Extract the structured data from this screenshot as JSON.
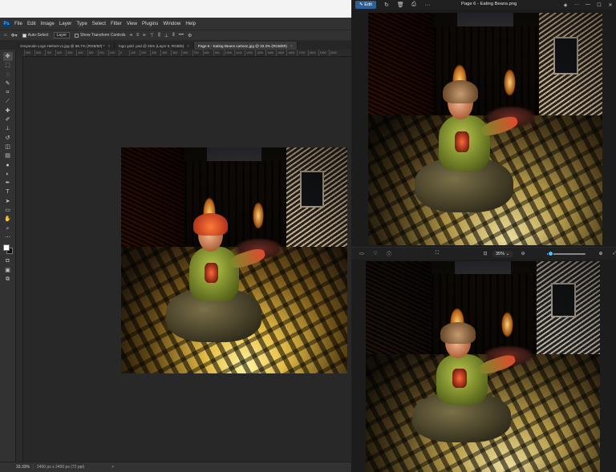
{
  "photoshop": {
    "logo": "Ps",
    "menu": [
      "File",
      "Edit",
      "Image",
      "Layer",
      "Type",
      "Select",
      "Filter",
      "View",
      "Plugins",
      "Window",
      "Help"
    ],
    "options": {
      "auto_select_label": "Auto-Select",
      "layer_select": "Layer",
      "transform_label": "Show Transform Controls"
    },
    "tabs": [
      {
        "label": "Greyscale Logo Helmet v1.jpg @ 66.7% (RGB/8#) *",
        "active": false
      },
      {
        "label": "logo gold .psd @ 25% (Layer 5, RGB/8)",
        "active": false
      },
      {
        "label": "Page 6 - Eating Beans cartoon.jpg @ 33.3% (RGB/8#)",
        "active": true
      }
    ],
    "ruler_ticks": [
      "900",
      "800",
      "700",
      "600",
      "500",
      "400",
      "300",
      "200",
      "100",
      "0",
      "100",
      "200",
      "300",
      "400",
      "500",
      "600",
      "700",
      "800",
      "900",
      "1000",
      "1100",
      "1200",
      "1300",
      "1400",
      "1500",
      "1600",
      "1700",
      "1800",
      "1900",
      "2000"
    ],
    "status": {
      "zoom": "33.33%",
      "doc_info": "2400 px x 2400 px (72 ppi)",
      "arrow": ">"
    }
  },
  "viewer": {
    "edit_label": "Edit",
    "title": "Page 6 - Eating Beans.png",
    "zoom_value": "35%",
    "zoom_level": 0.08
  }
}
